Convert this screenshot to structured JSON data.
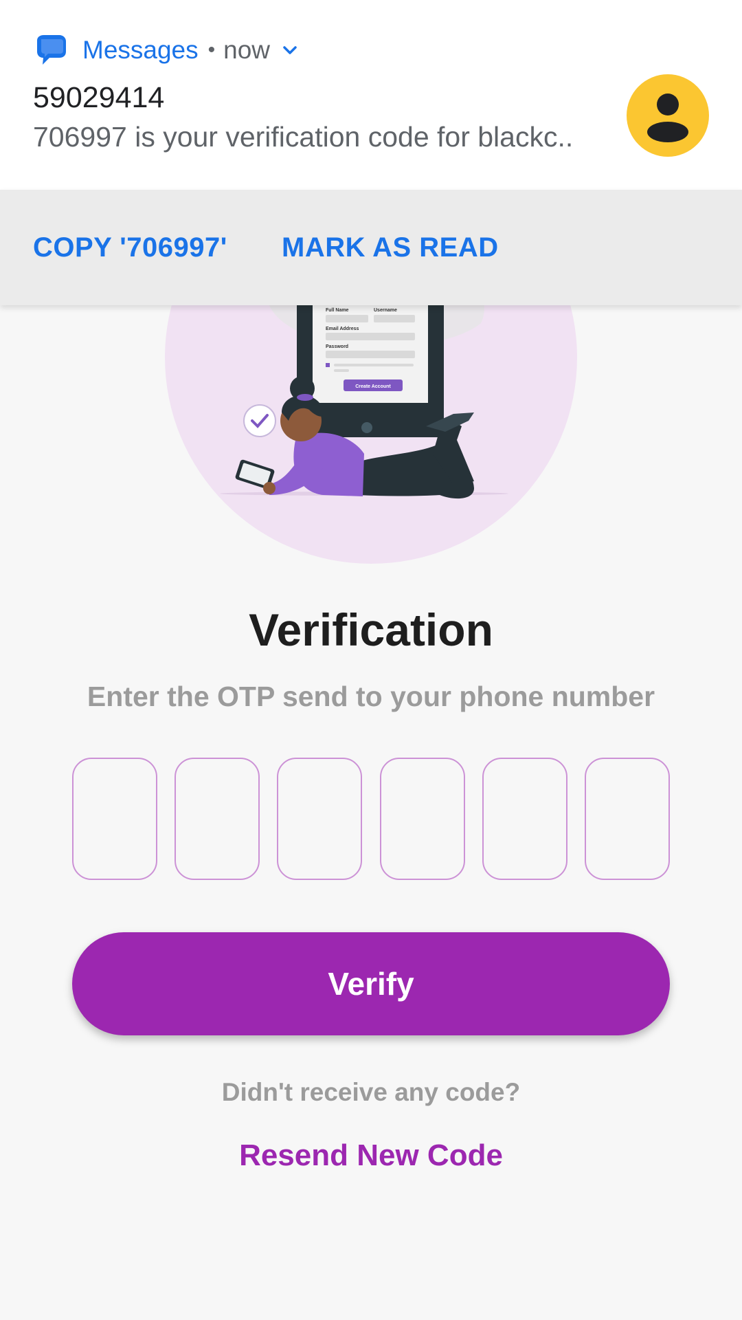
{
  "notification": {
    "app_name": "Messages",
    "separator": "•",
    "time": "now",
    "sender": "59029414",
    "preview": "706997 is your verification code for blackc..",
    "actions": {
      "copy": "COPY '706997'",
      "mark_read": "MARK AS READ"
    },
    "colors": {
      "accent": "#1a73e8",
      "avatar": "#fbc631"
    },
    "icons": [
      "messages-app-icon",
      "chevron-down-icon",
      "person-icon"
    ]
  },
  "illustration": {
    "form_labels": {
      "full_name": "Full Name",
      "username": "Username",
      "email": "Email Address",
      "password": "Password"
    },
    "button": "Create Account"
  },
  "screen": {
    "title": "Verification",
    "subtitle": "Enter the OTP send to your phone number",
    "otp": {
      "digit_count": 6,
      "values": [
        "",
        "",
        "",
        "",
        "",
        ""
      ]
    },
    "verify_button": "Verify",
    "no_code_text": "Didn't receive any code?",
    "resend_link": "Resend New Code",
    "colors": {
      "primary": "#9c27b0",
      "otp_border": "#cc92d6"
    }
  }
}
